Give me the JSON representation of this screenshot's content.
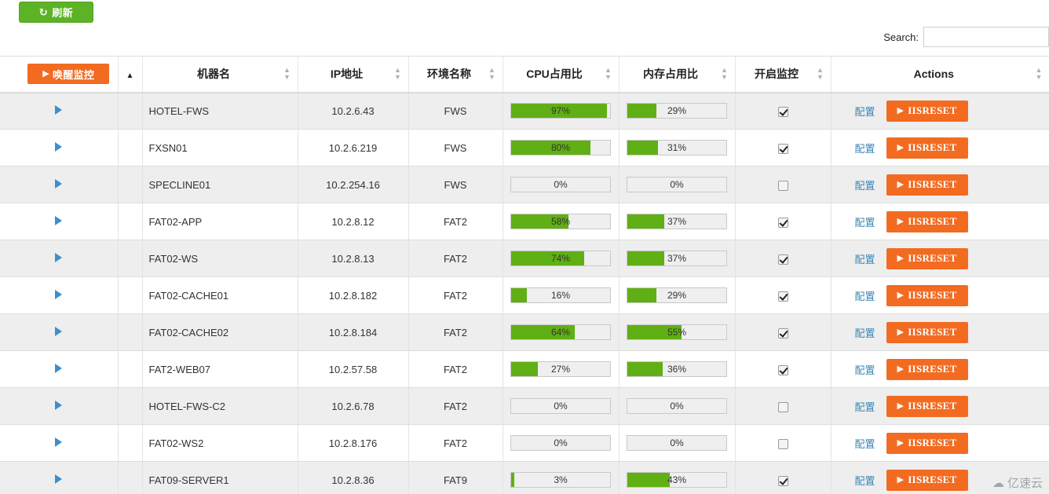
{
  "toolbar": {
    "refresh_label": "刷新",
    "refresh_icon": "refresh-icon",
    "refresh_color": "#5cb326"
  },
  "search": {
    "label": "Search:",
    "value": "",
    "placeholder": ""
  },
  "table": {
    "headers": {
      "wake_button_label": "唤醒监控",
      "wake_button_color": "#f26b21",
      "sort_arrow": "▲",
      "host": "机器名",
      "ip": "IP地址",
      "env": "环境名称",
      "cpu": "CPU占用比",
      "mem": "内存占用比",
      "monitor": "开启监控",
      "actions": "Actions"
    },
    "row_actions": {
      "config_label": "配置",
      "iisreset_label": "IISRESET",
      "iisreset_color": "#f26b21",
      "expand_icon": "triangle-right-icon"
    },
    "rows": [
      {
        "host": "HOTEL-FWS",
        "ip": "10.2.6.43",
        "env": "FWS",
        "cpu": 97,
        "cpu_label": "97%",
        "mem": 29,
        "mem_label": "29%",
        "monitor": true
      },
      {
        "host": "FXSN01",
        "ip": "10.2.6.219",
        "env": "FWS",
        "cpu": 80,
        "cpu_label": "80%",
        "mem": 31,
        "mem_label": "31%",
        "monitor": true
      },
      {
        "host": "SPECLINE01",
        "ip": "10.2.254.16",
        "env": "FWS",
        "cpu": 0,
        "cpu_label": "0%",
        "mem": 0,
        "mem_label": "0%",
        "monitor": false
      },
      {
        "host": "FAT02-APP",
        "ip": "10.2.8.12",
        "env": "FAT2",
        "cpu": 58,
        "cpu_label": "58%",
        "mem": 37,
        "mem_label": "37%",
        "monitor": true
      },
      {
        "host": "FAT02-WS",
        "ip": "10.2.8.13",
        "env": "FAT2",
        "cpu": 74,
        "cpu_label": "74%",
        "mem": 37,
        "mem_label": "37%",
        "monitor": true
      },
      {
        "host": "FAT02-CACHE01",
        "ip": "10.2.8.182",
        "env": "FAT2",
        "cpu": 16,
        "cpu_label": "16%",
        "mem": 29,
        "mem_label": "29%",
        "monitor": true
      },
      {
        "host": "FAT02-CACHE02",
        "ip": "10.2.8.184",
        "env": "FAT2",
        "cpu": 64,
        "cpu_label": "64%",
        "mem": 55,
        "mem_label": "55%",
        "monitor": true
      },
      {
        "host": "FAT2-WEB07",
        "ip": "10.2.57.58",
        "env": "FAT2",
        "cpu": 27,
        "cpu_label": "27%",
        "mem": 36,
        "mem_label": "36%",
        "monitor": true
      },
      {
        "host": "HOTEL-FWS-C2",
        "ip": "10.2.6.78",
        "env": "FAT2",
        "cpu": 0,
        "cpu_label": "0%",
        "mem": 0,
        "mem_label": "0%",
        "monitor": false
      },
      {
        "host": "FAT02-WS2",
        "ip": "10.2.8.176",
        "env": "FAT2",
        "cpu": 0,
        "cpu_label": "0%",
        "mem": 0,
        "mem_label": "0%",
        "monitor": false
      },
      {
        "host": "FAT09-SERVER1",
        "ip": "10.2.8.36",
        "env": "FAT9",
        "cpu": 3,
        "cpu_label": "3%",
        "mem": 43,
        "mem_label": "43%",
        "monitor": true
      }
    ]
  },
  "watermark": {
    "text": "亿速云",
    "icon": "cloud-icon"
  }
}
